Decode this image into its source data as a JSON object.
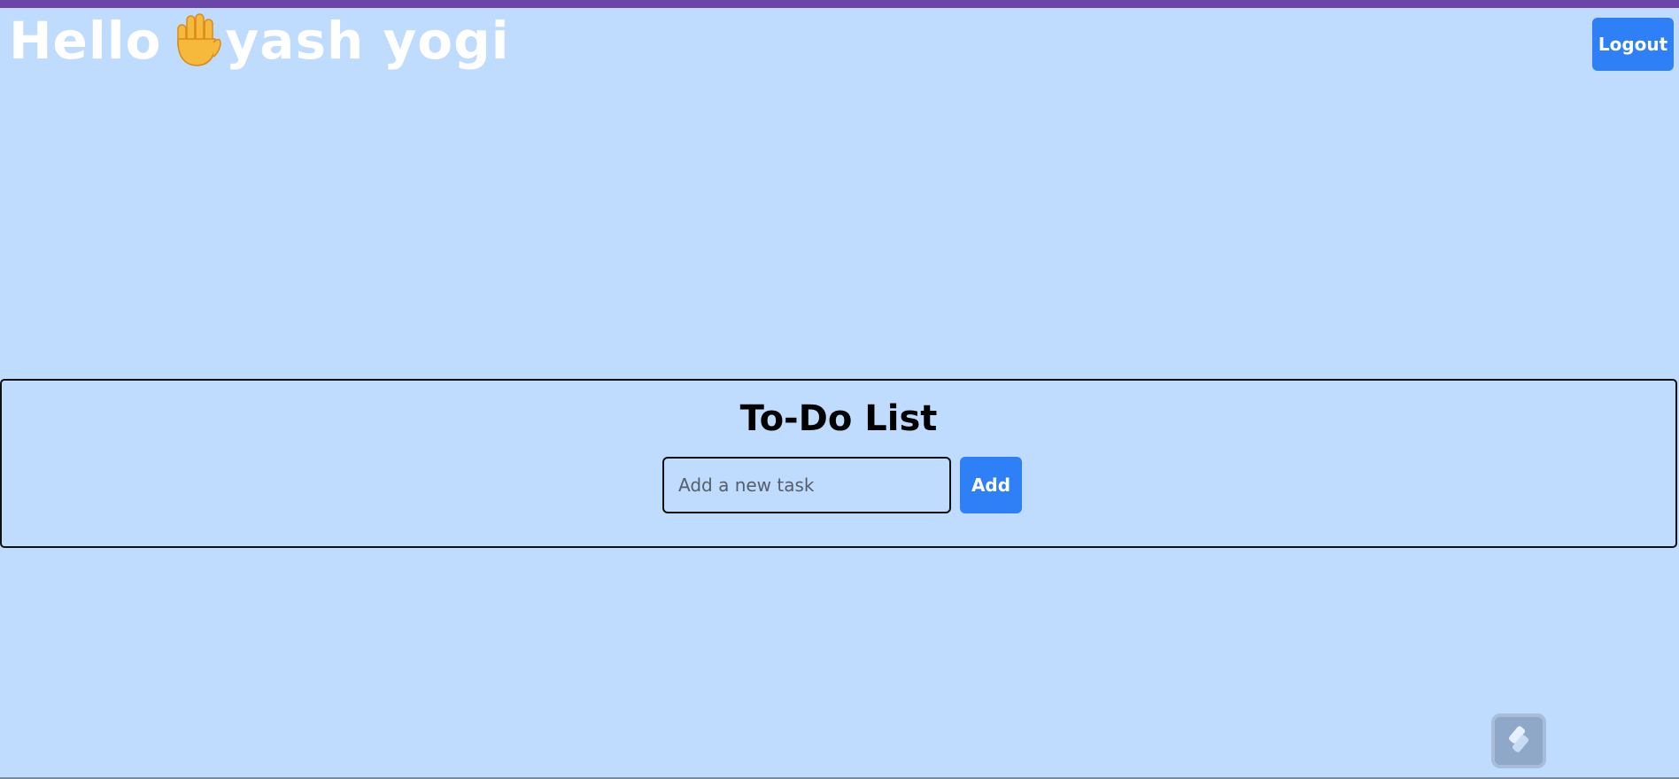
{
  "header": {
    "greeting_prefix": "Hello",
    "wave_icon": "raised-hand-icon",
    "user_name": "yash yogi",
    "logout_label": "Logout"
  },
  "todo": {
    "title": "To-Do List",
    "input_value": "",
    "input_placeholder": "Add a new task",
    "add_label": "Add"
  },
  "widget": {
    "icon": "assistant-launcher-icon"
  },
  "colors": {
    "background": "#bfdbfe",
    "top_bar": "#6b46a8",
    "primary_button": "#2f80f7",
    "greeting_text": "#ffffff"
  }
}
